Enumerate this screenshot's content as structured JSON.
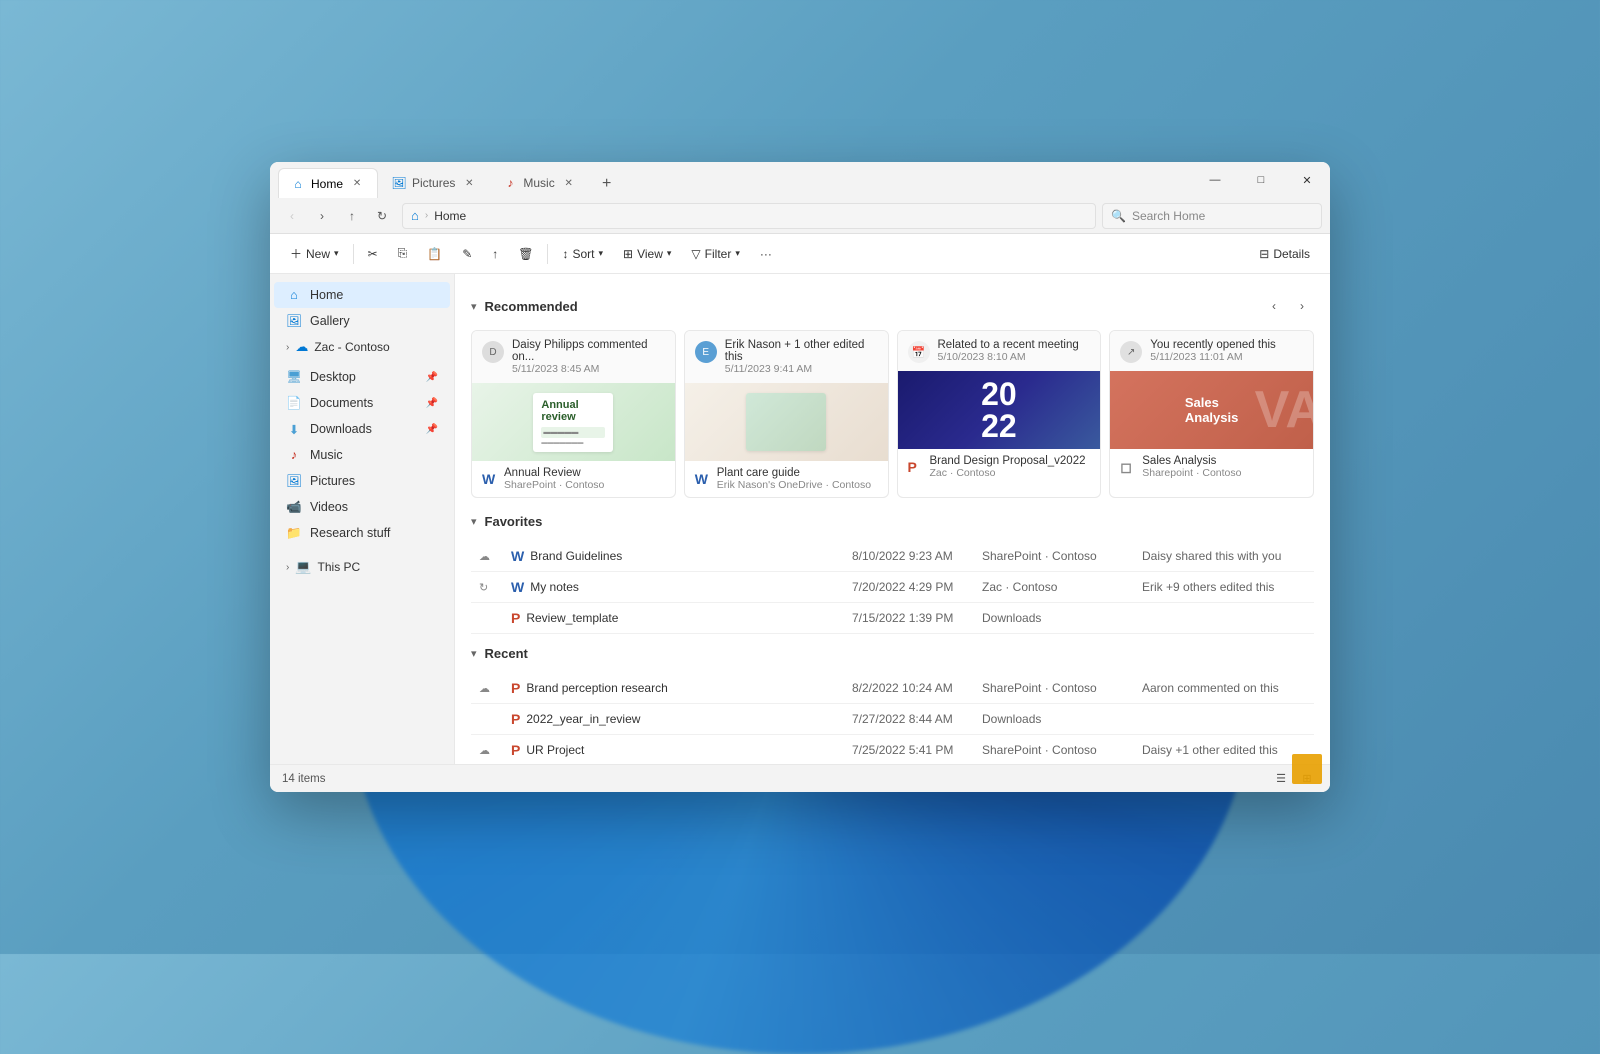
{
  "window": {
    "tabs": [
      {
        "label": "Home",
        "icon": "home",
        "active": true
      },
      {
        "label": "Pictures",
        "icon": "pictures",
        "active": false
      },
      {
        "label": "Music",
        "icon": "music",
        "active": false
      }
    ],
    "controls": {
      "minimize": "—",
      "maximize": "□",
      "close": "✕"
    },
    "add_tab": "+"
  },
  "toolbar": {
    "back": "‹",
    "forward": "›",
    "up": "↑",
    "refresh": "↻",
    "home": "⌂",
    "chevron": "›",
    "address": "Home",
    "search_placeholder": "Search Home"
  },
  "command_bar": {
    "new_label": "New",
    "cut_icon": "✂",
    "copy_icon": "⎘",
    "paste_icon": "📋",
    "rename_icon": "✎",
    "share_icon": "↑",
    "delete_icon": "🗑",
    "sort_label": "Sort",
    "view_label": "View",
    "filter_label": "Filter",
    "more_icon": "···",
    "details_label": "Details"
  },
  "sidebar": {
    "items": [
      {
        "label": "Home",
        "icon": "home",
        "active": true
      },
      {
        "label": "Gallery",
        "icon": "gallery"
      },
      {
        "label": "Zac - Contoso",
        "icon": "cloud",
        "expandable": true
      }
    ],
    "quick_access": [
      {
        "label": "Desktop",
        "icon": "desktop",
        "pinned": true
      },
      {
        "label": "Documents",
        "icon": "documents",
        "pinned": true
      },
      {
        "label": "Downloads",
        "icon": "downloads",
        "pinned": true
      },
      {
        "label": "Music",
        "icon": "music",
        "pinned": false
      },
      {
        "label": "Pictures",
        "icon": "pictures",
        "pinned": false
      },
      {
        "label": "Videos",
        "icon": "videos",
        "pinned": false
      },
      {
        "label": "Research stuff",
        "icon": "folder"
      }
    ],
    "this_pc": {
      "label": "This PC",
      "expandable": true
    }
  },
  "recommended": {
    "section_title": "Recommended",
    "cards": [
      {
        "user": "Daisy Philipps",
        "action": "commented on...",
        "date": "5/11/2023 8:45 AM",
        "filename": "Annual Review",
        "location": "SharePoint · Contoso",
        "preview_type": "annual"
      },
      {
        "user": "Erik Nason",
        "action": "+ 1 other edited this",
        "date": "5/11/2023 9:41 AM",
        "filename": "Plant care guide",
        "location": "Erik Nason's OneDrive · Contoso",
        "preview_type": "plant"
      },
      {
        "user": "Related to a recent meeting",
        "action": "",
        "date": "5/10/2023 8:10 AM",
        "filename": "Brand Design Proposal_v2022",
        "location": "Zac · Contoso",
        "preview_type": "brand"
      },
      {
        "user": "You",
        "action": "recently opened this",
        "date": "5/11/2023 11:01 AM",
        "filename": "Sales Analysis",
        "location": "Sharepoint · Contoso",
        "preview_type": "sales"
      }
    ]
  },
  "favorites": {
    "section_title": "Favorites",
    "items": [
      {
        "name": "Brand Guidelines",
        "date": "8/10/2022 9:23 AM",
        "location": "SharePoint · Contoso",
        "activity": "Daisy shared this with you",
        "cloud": true,
        "type": "word"
      },
      {
        "name": "My notes",
        "date": "7/20/2022 4:29 PM",
        "location": "Zac · Contoso",
        "activity": "Erik +9 others edited this",
        "cloud": true,
        "type": "word"
      },
      {
        "name": "Review_template",
        "date": "7/15/2022 1:39 PM",
        "location": "Downloads",
        "activity": "",
        "cloud": false,
        "type": "ppt"
      }
    ]
  },
  "recent": {
    "section_title": "Recent",
    "items": [
      {
        "name": "Brand perception research",
        "date": "8/2/2022 10:24 AM",
        "location": "SharePoint · Contoso",
        "activity": "Aaron commented on this",
        "cloud": true,
        "type": "ppt"
      },
      {
        "name": "2022_year_in_review",
        "date": "7/27/2022 8:44 AM",
        "location": "Downloads",
        "activity": "",
        "cloud": false,
        "type": "ppt"
      },
      {
        "name": "UR Project",
        "date": "7/25/2022 5:41 PM",
        "location": "SharePoint · Contoso",
        "activity": "Daisy +1 other edited this",
        "cloud": true,
        "type": "ppt"
      }
    ]
  },
  "status_bar": {
    "item_count": "14 items"
  }
}
